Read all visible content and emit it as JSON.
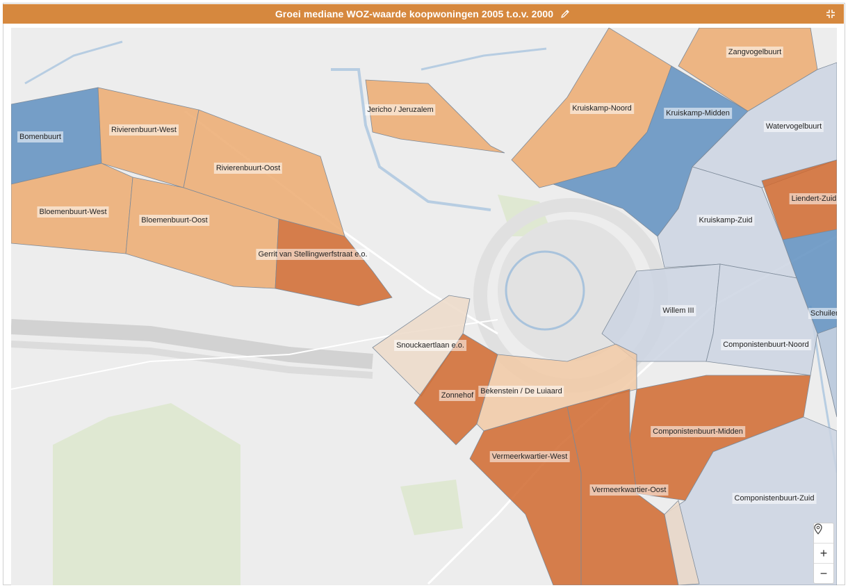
{
  "header": {
    "title": "Groei mediane WOZ-waarde koopwoningen 2005 t.o.v. 2000"
  },
  "colors": {
    "titlebar": "#d6883e",
    "high": "#d0692e",
    "medium": "#ecaa70",
    "light": "#f1c9a4",
    "pale": "#ecd9c8",
    "low": "#5f8fbf",
    "neutral": "#cbd4e2",
    "basemap": "#ededed"
  },
  "map": {
    "neighbourhoods": [
      {
        "name": "Bomenbuurt",
        "class": "low"
      },
      {
        "name": "Rivierenbuurt-West",
        "class": "medium"
      },
      {
        "name": "Rivierenbuurt-Oost",
        "class": "medium"
      },
      {
        "name": "Bloemenbuurt-West",
        "class": "medium"
      },
      {
        "name": "Bloemenbuurt-Oost",
        "class": "medium"
      },
      {
        "name": "Gerrit van Stellingwerfstraat e.o.",
        "class": "high"
      },
      {
        "name": "Jericho / Jeruzalem",
        "class": "medium"
      },
      {
        "name": "Kruiskamp-Noord",
        "class": "medium"
      },
      {
        "name": "Zangvogelbuurt",
        "class": "medium"
      },
      {
        "name": "Kruiskamp-Midden",
        "class": "low"
      },
      {
        "name": "Watervogelbuurt",
        "class": "neutral"
      },
      {
        "name": "Liendert-Zuid",
        "class": "high"
      },
      {
        "name": "Kruiskamp-Zuid",
        "class": "neutral"
      },
      {
        "name": "Willem III",
        "class": "neutral"
      },
      {
        "name": "Schuilen",
        "class": "neutral"
      },
      {
        "name": "Componistenbuurt-Noord",
        "class": "neutral"
      },
      {
        "name": "Snouckaertlaan e.o.",
        "class": "pale"
      },
      {
        "name": "Zonnehof",
        "class": "high"
      },
      {
        "name": "Bekenstein / De Luiaard",
        "class": "light"
      },
      {
        "name": "Componistenbuurt-Midden",
        "class": "high"
      },
      {
        "name": "Vermeerkwartier-West",
        "class": "high"
      },
      {
        "name": "Vermeerkwartier-Oost",
        "class": "high"
      },
      {
        "name": "Componistenbuurt-Zuid",
        "class": "neutral"
      }
    ]
  },
  "controls": {
    "location_icon": "location-pin-icon",
    "zoom_in": "+",
    "zoom_out": "−"
  }
}
